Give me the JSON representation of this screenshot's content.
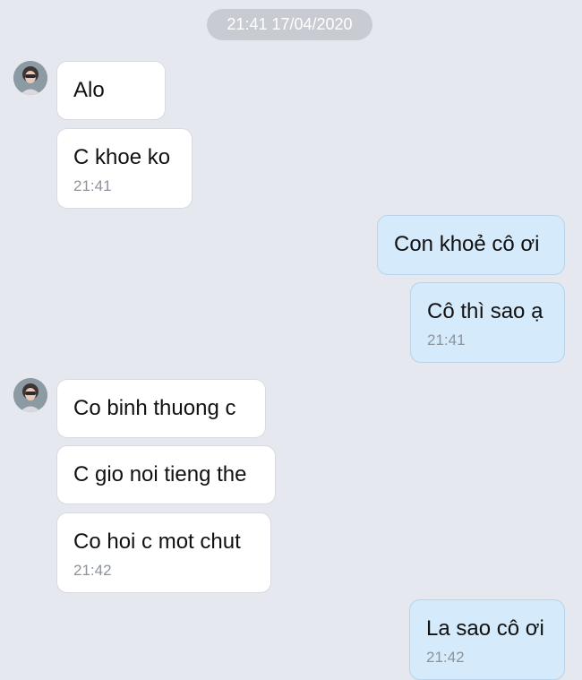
{
  "header": {
    "date_stamp": "21:41 17/04/2020"
  },
  "messages": [
    {
      "text": "Alo",
      "time": ""
    },
    {
      "text": "C khoe ko",
      "time": "21:41"
    },
    {
      "text": "Con khoẻ cô ơi",
      "time": ""
    },
    {
      "text": "Cô thì sao ạ",
      "time": "21:41"
    },
    {
      "text": "Co binh thuong c",
      "time": ""
    },
    {
      "text": "C gio noi tieng the",
      "time": ""
    },
    {
      "text": "Co hoi c mot chut",
      "time": "21:42"
    },
    {
      "text": "La sao cô ơi",
      "time": "21:42"
    }
  ],
  "colors": {
    "background": "#e6e8f0",
    "incoming_bubble": "#ffffff",
    "outgoing_bubble": "#d5eafb",
    "timestamp": "#8d939b",
    "date_pill": "#c8cbd2"
  }
}
